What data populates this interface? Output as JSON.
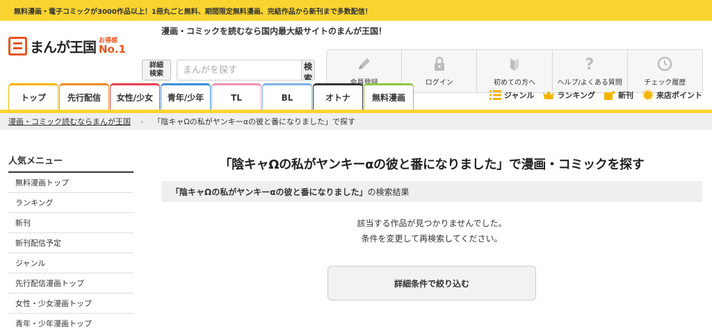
{
  "banner": {
    "main": "漫画・コミックを読むなら国内最大級サイトのまんが王国！",
    "sub": "無料漫画・電子コミックが3000作品以上！1冊丸ごと無料、期間限定無料漫画、完結作品から新刊まで多数配信！"
  },
  "logo": {
    "name": "まんが王国",
    "badge_top": "お得感",
    "badge_bottom": "No.1"
  },
  "search": {
    "advanced_label_1": "詳細",
    "advanced_label_2": "検索",
    "placeholder": "まんがを探す",
    "button": "検索"
  },
  "quick_links": [
    {
      "label": "会員登録",
      "icon": "pencil-icon"
    },
    {
      "label": "ログイン",
      "icon": "lock-icon"
    },
    {
      "label": "初めての方へ",
      "icon": "beginner-mark-icon"
    },
    {
      "label": "ヘルプ/よくある質問",
      "icon": "question-icon"
    },
    {
      "label": "チェック履歴",
      "icon": "clock-icon"
    }
  ],
  "tabs": [
    {
      "label": "トップ",
      "color": "#f3b400",
      "width": 72
    },
    {
      "label": "先行配信",
      "color": "#f08a1c",
      "width": 72
    },
    {
      "label": "女性/少女",
      "color": "#e6404e",
      "width": 72
    },
    {
      "label": "青年/少年",
      "color": "#3c8fd8",
      "width": 72
    },
    {
      "label": "TL",
      "color": "#f090b4",
      "width": 72
    },
    {
      "label": "BL",
      "color": "#7cb4e6",
      "width": 72
    },
    {
      "label": "オトナ",
      "color": "#333333",
      "width": 72
    },
    {
      "label": "無料漫画",
      "color": "#8cc63f",
      "width": 72
    }
  ],
  "right_links": [
    {
      "label": "ジャンル",
      "icon": "list-icon"
    },
    {
      "label": "ランキング",
      "icon": "crown-icon"
    },
    {
      "label": "新刊",
      "icon": "new-book-icon"
    },
    {
      "label": "来店ポイント",
      "icon": "point-icon"
    }
  ],
  "breadcrumb": {
    "home": "漫画・コミック読むならまんが王国",
    "current": "「陰キャΩの私がヤンキーαの彼と番になりました」で探す"
  },
  "sidebar": {
    "title": "人気メニュー",
    "items": [
      "無料漫画トップ",
      "ランキング",
      "新刊",
      "新刊配信予定",
      "ジャンル",
      "先行配信漫画トップ",
      "女性・少女漫画トップ",
      "青年・少年漫画トップ"
    ]
  },
  "main": {
    "heading": "「陰キャΩの私がヤンキーαの彼と番になりました」で漫画・コミックを探す",
    "result_query": "「陰キャΩの私がヤンキーαの彼と番になりました」",
    "result_suffix": "の検索結果",
    "no_result_1": "該当する作品が見つかりませんでした。",
    "no_result_2": "条件を変更して再検索してください。",
    "refine_button": "詳細条件で絞り込む"
  }
}
